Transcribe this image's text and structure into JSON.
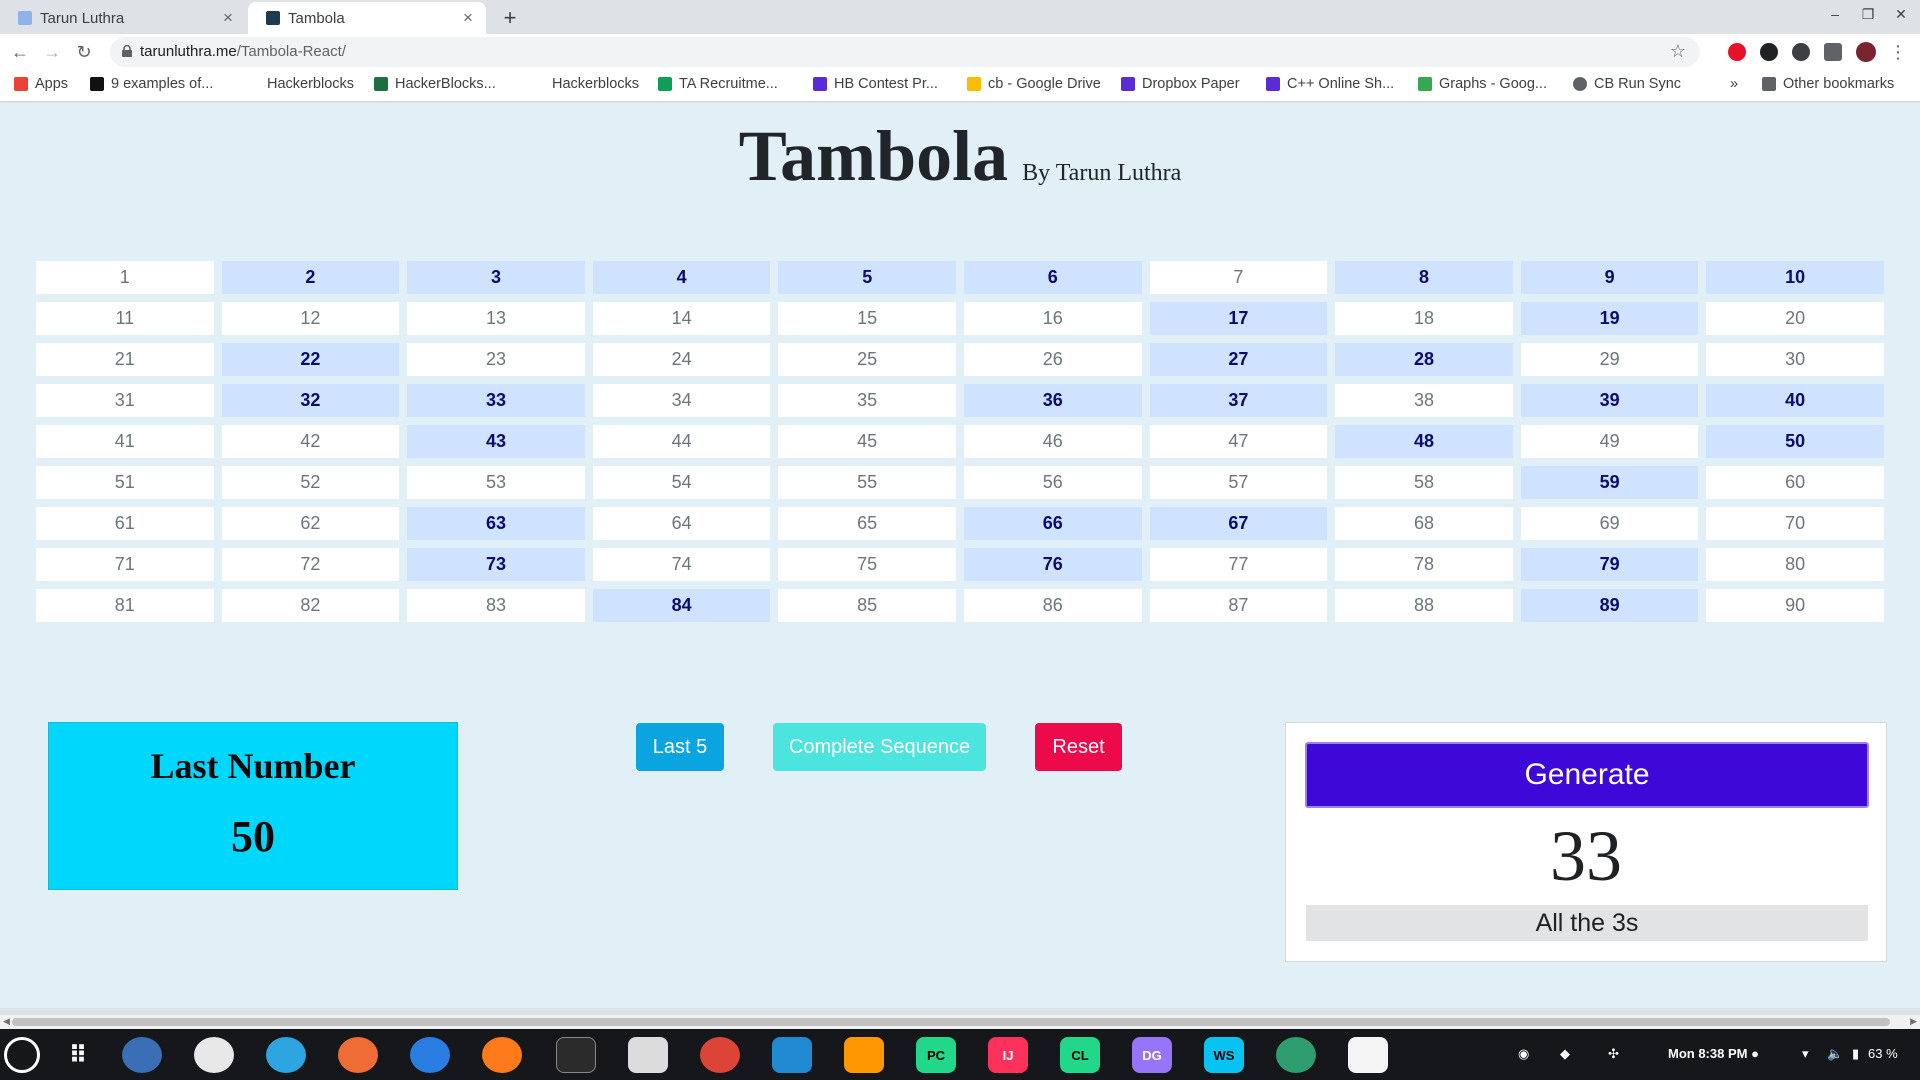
{
  "browser": {
    "tabs": [
      {
        "label": "Tarun Luthra",
        "active": false
      },
      {
        "label": "Tambola",
        "active": true
      }
    ],
    "url_host": "tarunluthra.me",
    "url_path": "/Tambola-React/",
    "bookmarks": [
      "Apps",
      "9 examples of...",
      "Hackerblocks",
      "HackerBlocks...",
      "Hackerblocks",
      "TA Recruitme...",
      "HB Contest Pr...",
      "cb - Google Drive",
      "Dropbox Paper",
      "C++ Online Sh...",
      "Graphs - Goog...",
      "CB Run Sync",
      "Other bookmarks"
    ],
    "bookmarks_overflow": "»"
  },
  "page": {
    "title": "Tambola",
    "byline": "By Tarun Luthra",
    "board": {
      "numbers": [
        1,
        2,
        3,
        4,
        5,
        6,
        7,
        8,
        9,
        10,
        11,
        12,
        13,
        14,
        15,
        16,
        17,
        18,
        19,
        20,
        21,
        22,
        23,
        24,
        25,
        26,
        27,
        28,
        29,
        30,
        31,
        32,
        33,
        34,
        35,
        36,
        37,
        38,
        39,
        40,
        41,
        42,
        43,
        44,
        45,
        46,
        47,
        48,
        49,
        50,
        51,
        52,
        53,
        54,
        55,
        56,
        57,
        58,
        59,
        60,
        61,
        62,
        63,
        64,
        65,
        66,
        67,
        68,
        69,
        70,
        71,
        72,
        73,
        74,
        75,
        76,
        77,
        78,
        79,
        80,
        81,
        82,
        83,
        84,
        85,
        86,
        87,
        88,
        89,
        90
      ],
      "called": [
        2,
        3,
        4,
        5,
        6,
        8,
        9,
        10,
        17,
        19,
        22,
        27,
        28,
        32,
        33,
        36,
        37,
        39,
        40,
        43,
        48,
        50,
        59,
        63,
        66,
        67,
        73,
        76,
        79,
        84,
        89
      ]
    },
    "last_number": {
      "title": "Last Number",
      "value": "50"
    },
    "buttons": {
      "last5": "Last 5",
      "sequence": "Complete Sequence",
      "reset": "Reset"
    },
    "generator": {
      "button": "Generate",
      "number": "33",
      "call_text": "All the 3s"
    }
  },
  "taskbar": {
    "apps": [
      "PC",
      "IJ",
      "CL",
      "DG",
      "WS"
    ],
    "clock": "Mon  8:38 PM ●",
    "battery": "63 %"
  },
  "colors": {
    "page_bg": "#e0f0f6",
    "called_bg": "#cfe2ff",
    "last_box": "#00d7fd",
    "generate": "#3e08d9",
    "reset": "#ec0a4b",
    "last5": "#0aa5e0",
    "sequence": "#4ce4de"
  }
}
